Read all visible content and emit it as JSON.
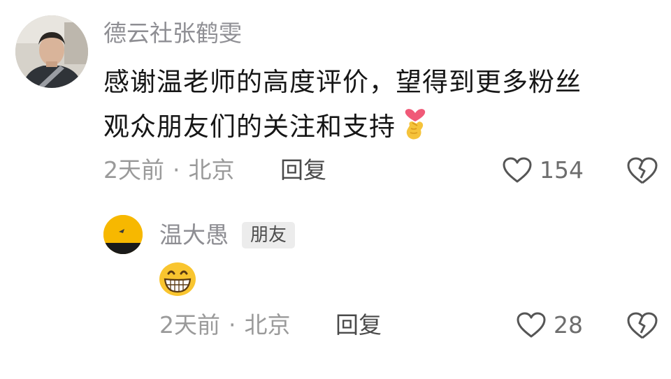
{
  "comment": {
    "username": "德云社张鹤雯",
    "text_line1": "感谢温老师的高度评价，望得到更多粉丝",
    "text_line2": "观众朋友们的关注和支持",
    "emoji": "finger-heart",
    "time": "2天前",
    "separator": "·",
    "location": "北京",
    "reply_label": "回复",
    "like_count": "154"
  },
  "reply": {
    "username": "温大愚",
    "badge": "朋友",
    "emoji": "grinning-face",
    "time": "2天前",
    "separator": "·",
    "location": "北京",
    "reply_label": "回复",
    "like_count": "28"
  },
  "colors": {
    "text": "#161616",
    "muted": "#9a9a9a",
    "badge_bg": "#ececec",
    "emoji_yellow": "#f7b800"
  }
}
